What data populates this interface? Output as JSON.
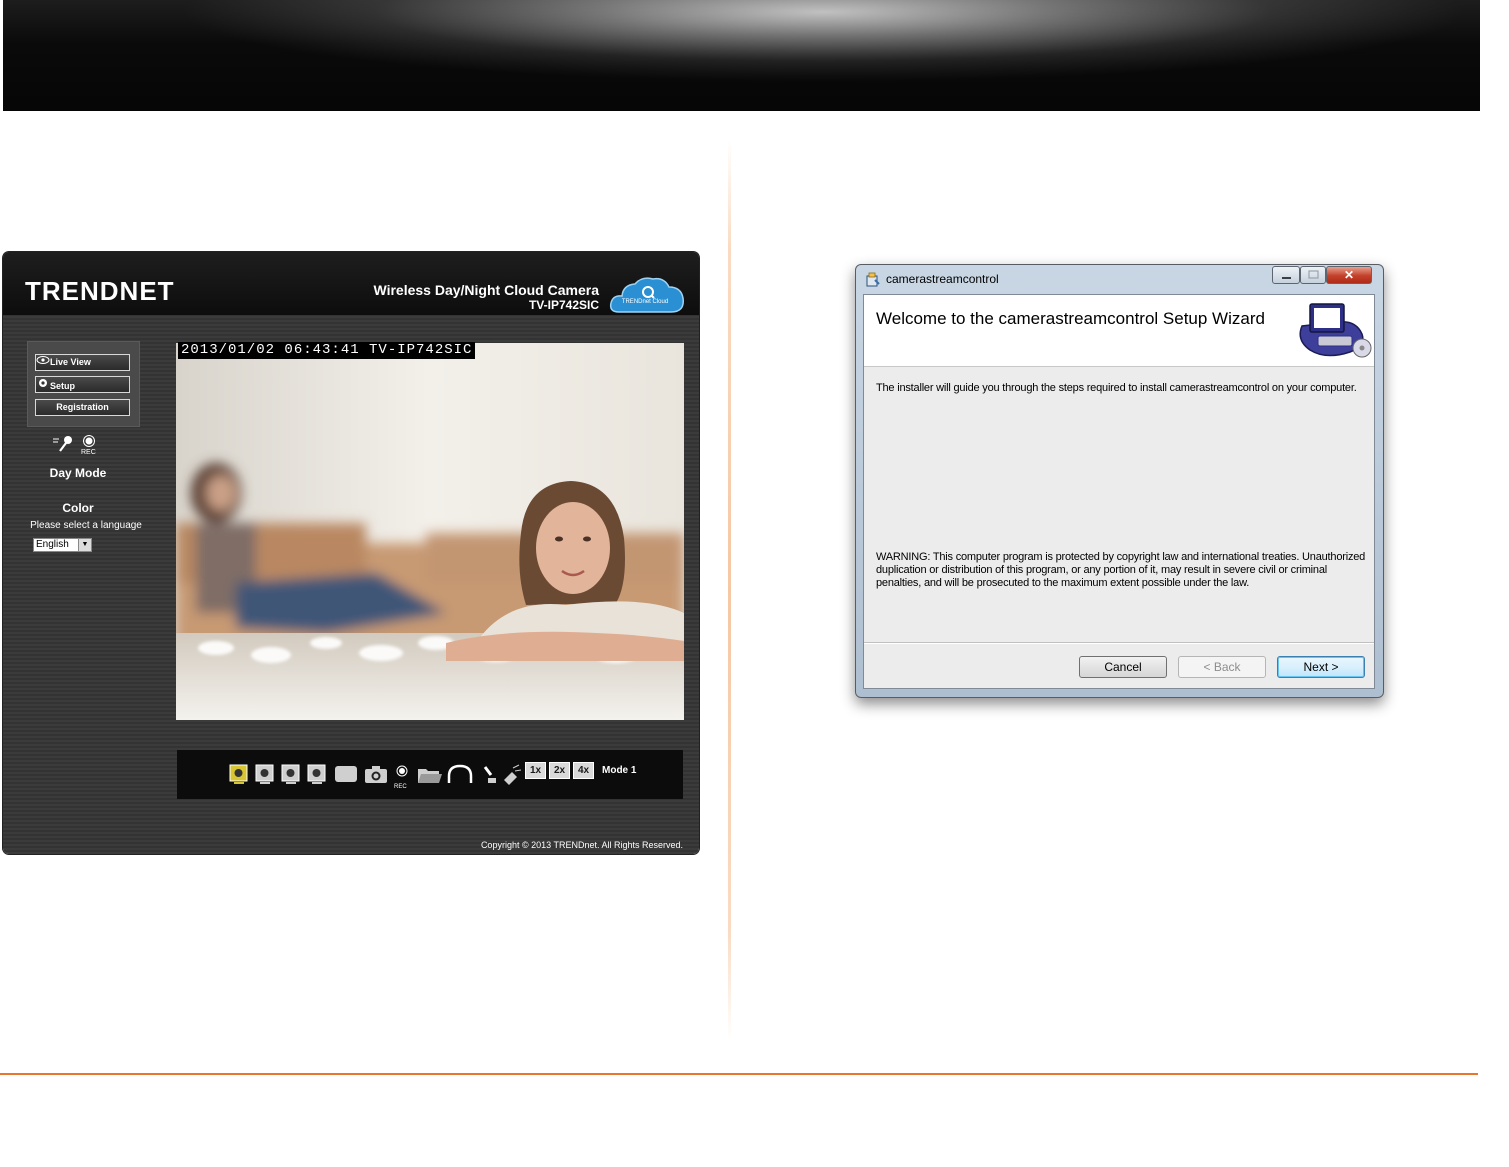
{
  "camera_ui": {
    "logo": "TRENDNET",
    "product_title": "Wireless Day/Night Cloud Camera",
    "model": "TV-IP742SIC",
    "cloud_badge": "TRENDnet Cloud",
    "nav": {
      "live_view": "Live View",
      "setup": "Setup",
      "registration": "Registration"
    },
    "rec_label": "REC",
    "day_mode": "Day Mode",
    "color": "Color",
    "language_prompt": "Please select a language",
    "language_value": "English",
    "osd_text": "2013/01/02 06:43:41 TV-IP742SIC",
    "toolbar": {
      "rec_label": "REC",
      "zoom": [
        "1x",
        "2x",
        "4x"
      ],
      "mode": "Mode 1"
    },
    "copyright": "Copyright © 2013 TRENDnet. All Rights Reserved."
  },
  "installer": {
    "window_title": "camerastreamcontrol",
    "heading": "Welcome to the camerastreamcontrol Setup Wizard",
    "intro": "The installer will guide you through the steps required to install camerastreamcontrol on your computer.",
    "warning": "WARNING: This computer program is protected by copyright law and international treaties. Unauthorized duplication or distribution of this program, or any portion of it, may result in severe civil or criminal penalties, and will be prosecuted to the maximum extent possible under the law.",
    "buttons": {
      "cancel": "Cancel",
      "back": "< Back",
      "next": "Next >"
    }
  },
  "colors": {
    "accent_orange": "#e8762c",
    "camera_panel": "#3b3b3b",
    "dialog_frame": "#c9d6e4"
  }
}
